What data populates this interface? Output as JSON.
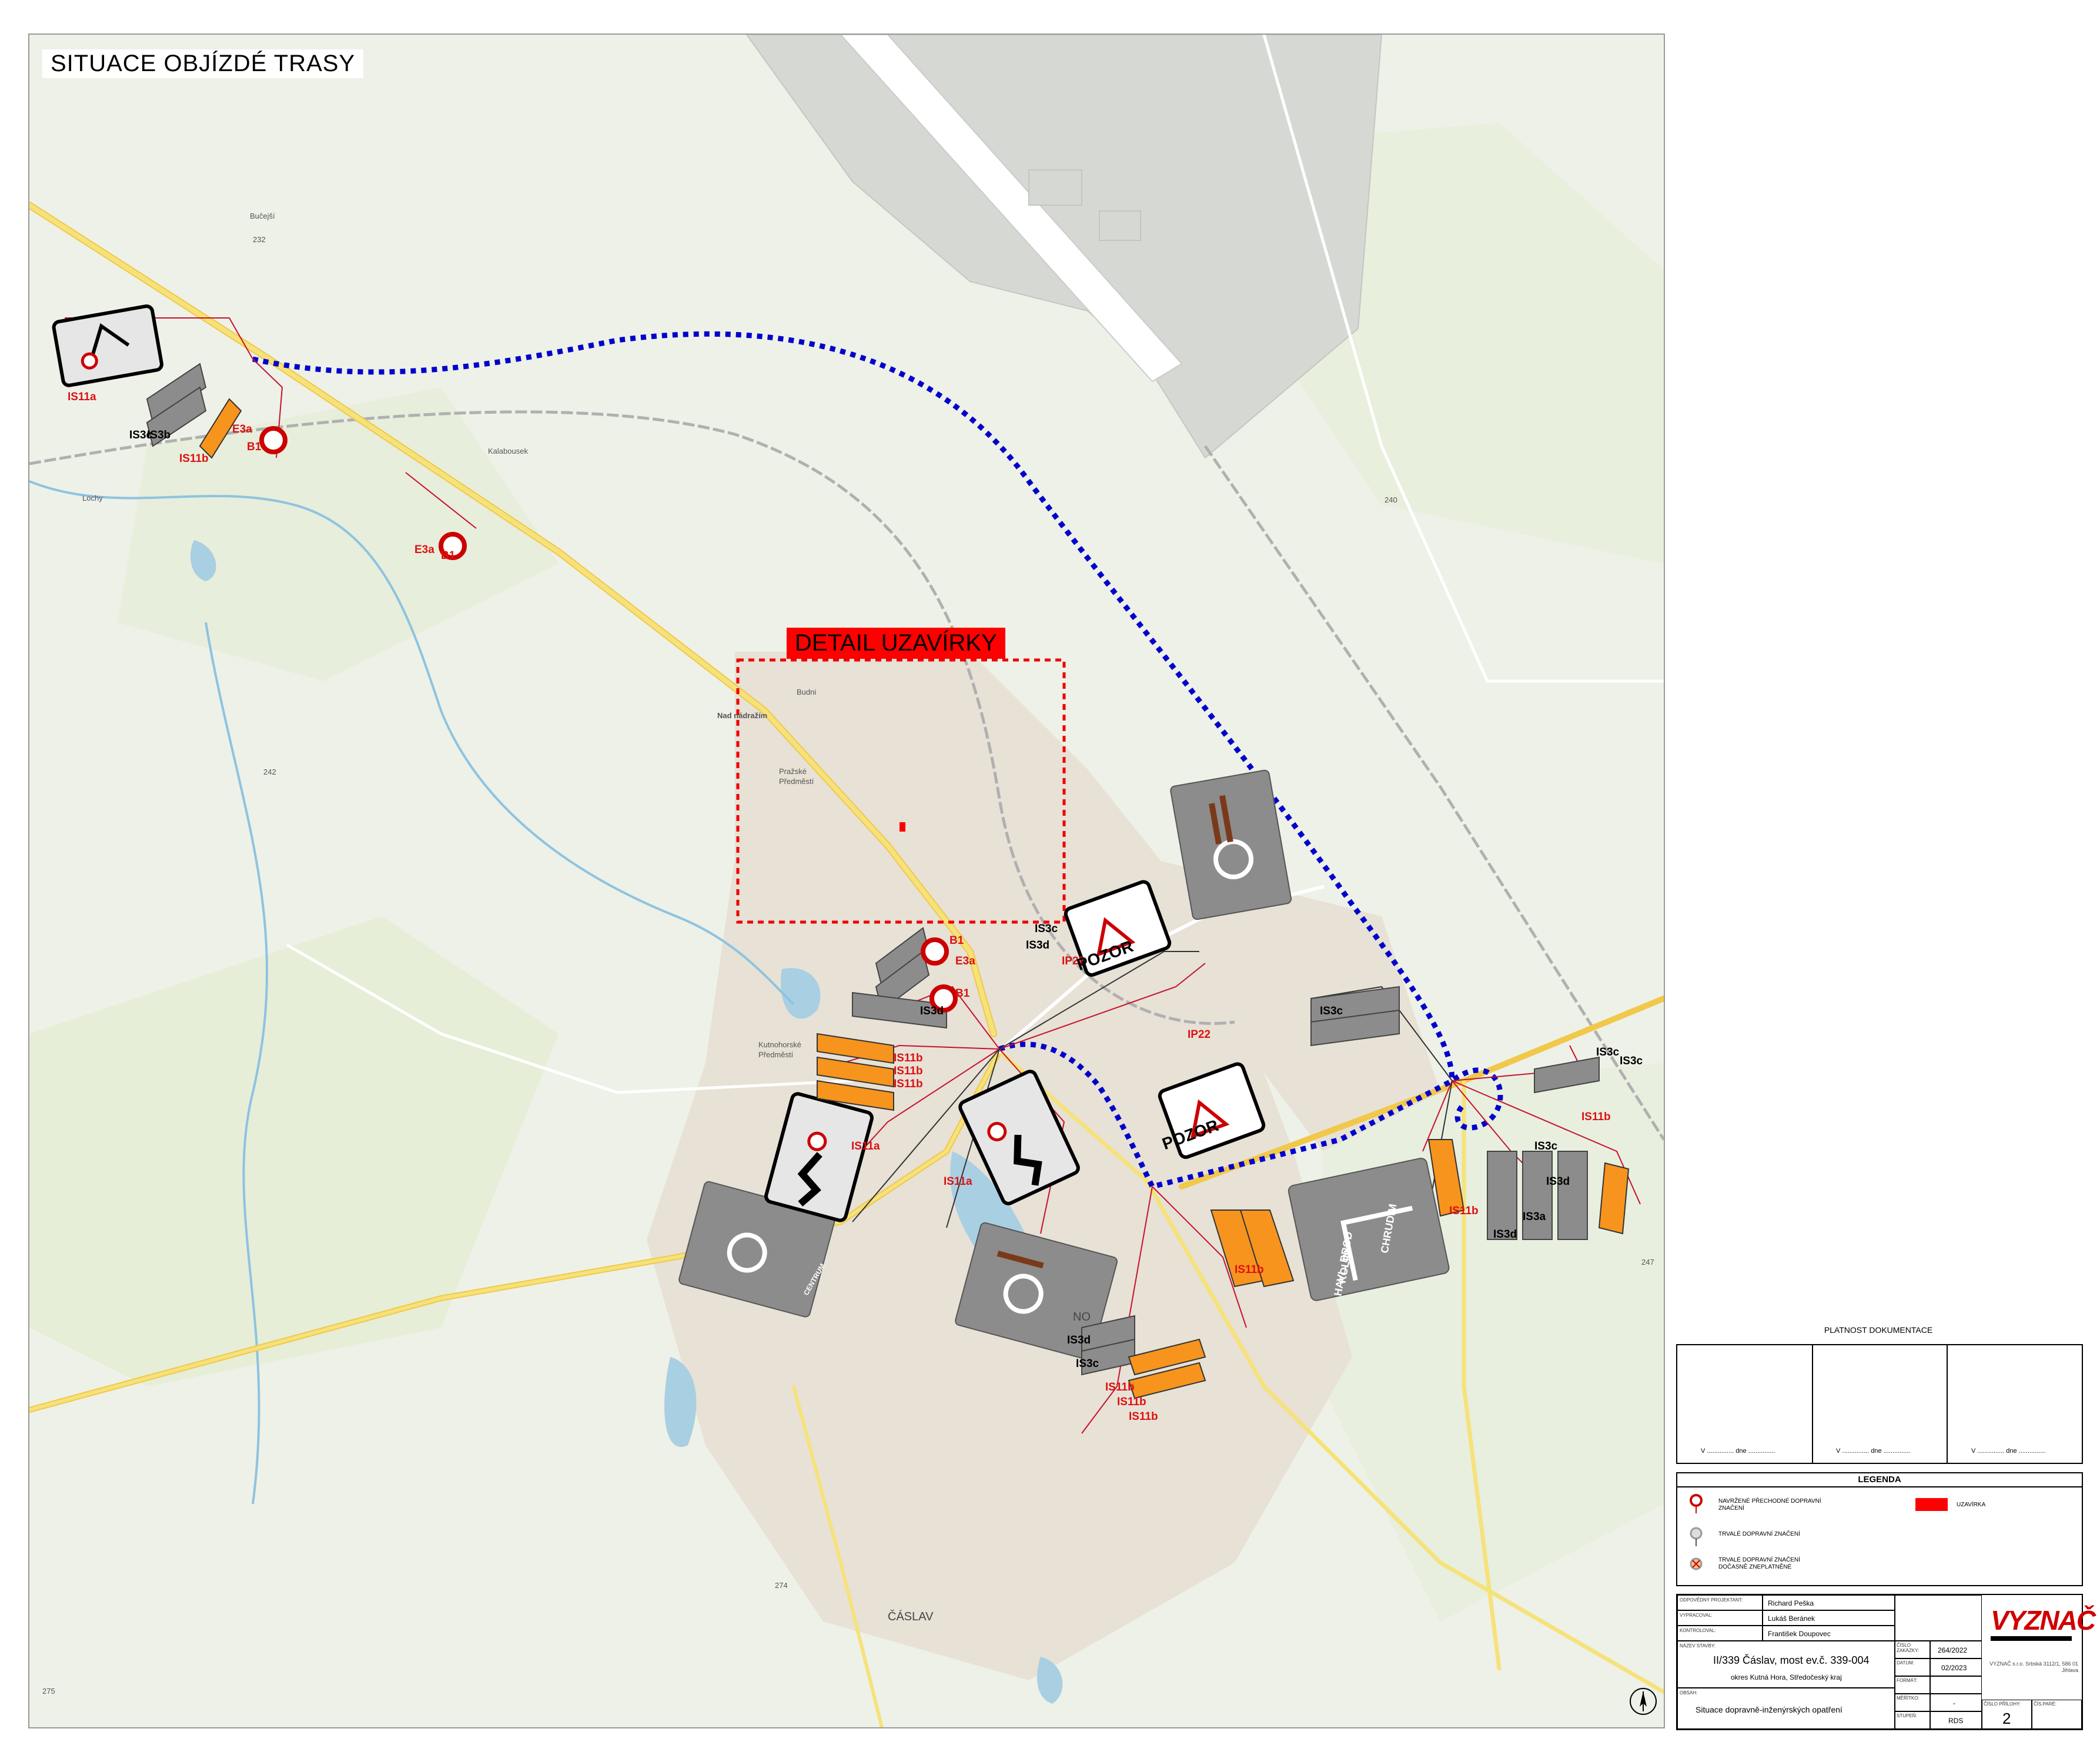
{
  "title": "SITUACE OBJÍZDÉ TRASY",
  "detail_label": "DETAIL UZAVÍRKY",
  "colors": {
    "detour_route": "#0000cc",
    "closure": "#ff0000",
    "temp_sign_orange": "#f7941d",
    "sign_gray": "#8c8c8c",
    "main_road_yellow": "#f6e27a",
    "map_background": "#eef1e7"
  },
  "places": {
    "budni": "Budni",
    "nadrazi": "Nad nádražím",
    "prazske": "Pražské",
    "predmesti1": "Předměstí",
    "kalabousek": "Kalabousek",
    "lochy": "Lochy",
    "kutnohorske": "Kutnohorské",
    "predmesti2": "Předměstí",
    "caslav": "ČÁSLAV",
    "hurky": "Bučejší",
    "nove_mesto": "NO",
    "elev_232": "232",
    "elev_240": "240",
    "elev_242": "242",
    "elev_274": "274",
    "elev_275": "275",
    "elev_247": "247"
  },
  "sign_codes": {
    "s1": "IS11a",
    "s2": "IS11b",
    "s3": "IS3c",
    "s4": "IS3b",
    "s5": "E3a",
    "s6": "B1",
    "s7": "B1",
    "s8": "E3a",
    "s9": "B1",
    "s10": "E3a",
    "s11": "B1",
    "s12": "IS3d",
    "s13": "IS11b",
    "s14": "IS11b",
    "s15": "IS11b",
    "s16": "IS11a",
    "s17": "IS11a",
    "s18": "IP22",
    "s19": "IP22",
    "s20": "IS3c",
    "s21": "IS3d",
    "s22": "IS3c",
    "s23": "IS3c",
    "s24": "IS11b",
    "s25": "IS11b",
    "s26": "IS3a",
    "s27": "IS3d",
    "s28": "IS11b",
    "s29": "IS3c",
    "s30": "IS3d",
    "s31": "IS11b",
    "s32": "IS11b",
    "s33": "IS11b",
    "s34": "IS3c",
    "s35": "IS3d",
    "s36": "IS3c"
  },
  "pozor": {
    "text": "POZOR"
  },
  "directions": {
    "chrudim": "CHRUDIM",
    "havl_brod": "HAVL. BROD",
    "kolin": "KOLÍN",
    "centrum": "CENTRUM"
  },
  "validity": {
    "title": "PLATNOST DOKUMENTACE",
    "sig1": "V ............... dne ...............",
    "sig2": "V ............... dne ...............",
    "sig3": "V ............... dne ..............."
  },
  "legend": {
    "title": "LEGENDA",
    "item1": "NAVRŽENÉ PŘECHODNÉ DOPRAVNÍ ZNAČENÍ",
    "item2": "TRVALÉ DOPRAVNÍ ZNAČENÍ",
    "item3": "TRVALÉ DOPRAVNÍ ZNAČENÍ DOČASNĚ ZNEPLATNĚNÉ",
    "item4": "UZAVÍRKA",
    "b1": "B1"
  },
  "title_block": {
    "l_resp": "ODPOVĚDNÝ PROJEKTANT:",
    "resp": "Richard Peška",
    "l_made": "VYPRACOVAL:",
    "made": "Lukáš Beránek",
    "l_check": "KONTROLOVAL:",
    "check": "František Doupovec",
    "l_name": "NÁZEV STAVBY:",
    "project": "II/339 Čáslav, most ev.č. 339-004",
    "region": "okres Kutná Hora, Středočeský kraj",
    "l_content": "OBSAH:",
    "content": "Situace dopravně-inženýrských opatření",
    "l_job": "ČÍSLO ZAKÁZKY:",
    "job": "264/2022",
    "l_date": "DATUM:",
    "date": "02/2023",
    "l_format": "FORMÁT:",
    "format": "",
    "l_scale": "MĚŘÍTKO:",
    "scale": "-",
    "l_stage": "STUPEŇ:",
    "stage": "RDS",
    "l_attach": "ČÍSLO PŘÍLOHY:",
    "attach": "2",
    "l_copy": "ČÍS.PARÉ:",
    "copy": ""
  },
  "logo": {
    "text": "VYZNAČ",
    "company": "VYZNAČ s.r.o. Srbská 3112/1, 586 01 Jihlava"
  }
}
